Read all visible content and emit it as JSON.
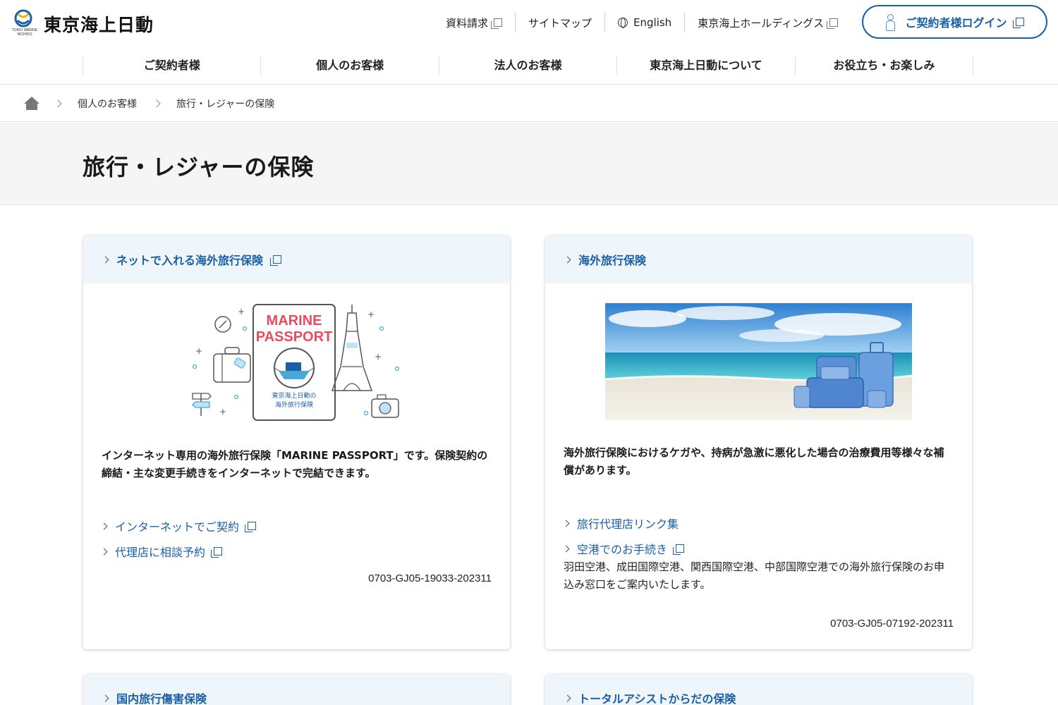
{
  "header": {
    "logo_name": "東京海上日動",
    "logo_sub": "TOKIO MARINE NICHIDO",
    "util_links": [
      {
        "label": "資料請求",
        "external": true
      },
      {
        "label": "サイトマップ",
        "external": false
      },
      {
        "label": "English",
        "external": false
      },
      {
        "label": "東京海上ホールディングス",
        "external": true
      }
    ],
    "login_label": "ご契約者様ログイン"
  },
  "nav": {
    "items": [
      "ご契約者様",
      "個人のお客様",
      "法人のお客様",
      "東京海上日動について",
      "お役立ち・お楽しみ"
    ]
  },
  "breadcrumb": {
    "items": [
      "個人のお客様",
      "旅行・レジャーの保険"
    ]
  },
  "page": {
    "title": "旅行・レジャーの保険"
  },
  "cards": [
    {
      "title": "ネットで入れる海外旅行保険",
      "image_text": {
        "line1": "MARINE",
        "line2": "PASSPORT",
        "caption1": "東京海上日動の",
        "caption2": "海外旅行保険"
      },
      "description": "インターネット専用の海外旅行保険「MARINE PASSPORT」です。保険契約の締結・主な変更手続きをインターネットで完結できます。",
      "links": [
        "インターネットでご契約",
        "代理店に相談予約"
      ],
      "code": "0703-GJ05-19033-202311"
    },
    {
      "title": "海外旅行保険",
      "description": "海外旅行保険におけるケガや、持病が急激に悪化した場合の治療費用等様々な補償があります。",
      "links": [
        "旅行代理店リンク集",
        "空港でのお手続き"
      ],
      "link_note": "羽田空港、成田国際空港、関西国際空港、中部国際空港での海外旅行保険のお申込み窓口をご案内いたします。",
      "code": "0703-GJ05-07192-202311"
    },
    {
      "title": "国内旅行傷害保険"
    },
    {
      "title": "トータルアシストからだの保険"
    }
  ]
}
